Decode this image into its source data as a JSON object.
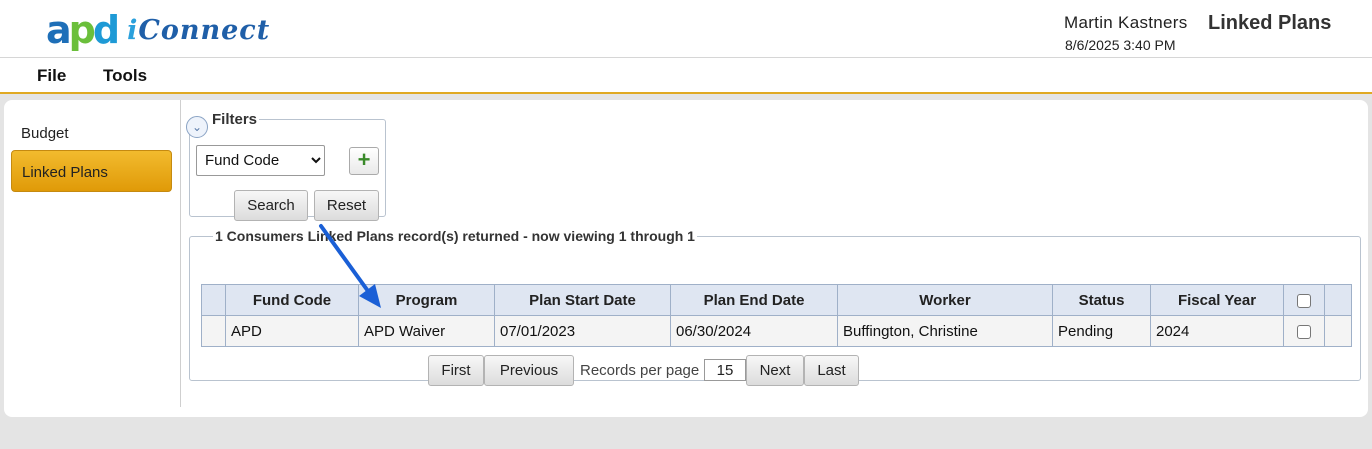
{
  "header": {
    "logo_apd": [
      "a",
      "p",
      "d"
    ],
    "logo_iconnect_prefix": "i",
    "logo_iconnect_rest": "Connect",
    "user_name": "Martin Kastners",
    "page_title": "Linked Plans",
    "datetime": "8/6/2025 3:40 PM"
  },
  "menu": {
    "file": "File",
    "tools": "Tools"
  },
  "sidebar": {
    "items": [
      {
        "label": "Budget",
        "active": false
      },
      {
        "label": "Linked Plans",
        "active": true
      }
    ]
  },
  "filters": {
    "legend": "Filters",
    "select_value": "Fund Code",
    "options": [
      "Fund Code"
    ],
    "add_label": "+",
    "search_label": "Search",
    "reset_label": "Reset"
  },
  "results": {
    "legend": "1 Consumers Linked Plans record(s) returned - now viewing 1 through 1",
    "columns": [
      "Fund Code",
      "Program",
      "Plan Start Date",
      "Plan End Date",
      "Worker",
      "Status",
      "Fiscal Year"
    ],
    "rows": [
      {
        "fund_code": "APD",
        "program": "APD Waiver",
        "plan_start": "07/01/2023",
        "plan_end": "06/30/2024",
        "worker": "Buffington, Christine",
        "status": "Pending",
        "fiscal_year": "2024"
      }
    ]
  },
  "pager": {
    "first": "First",
    "previous": "Previous",
    "records_label": "Records per page",
    "records_value": "15",
    "next": "Next",
    "last": "Last"
  },
  "colors": {
    "accent": "#e0a923",
    "sidebar_active": "#f2bb2e",
    "table_header": "#dfe6f2",
    "annotation_arrow": "#1a5fd6"
  }
}
